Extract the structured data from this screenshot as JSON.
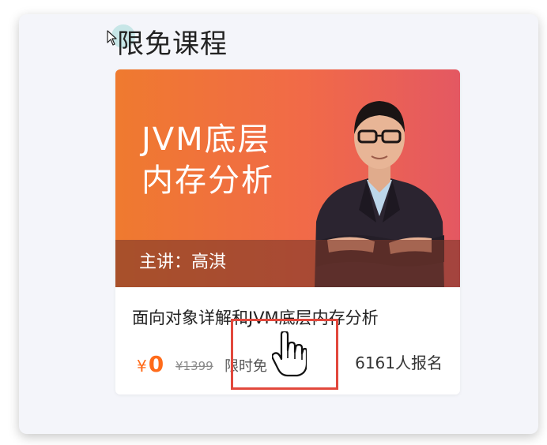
{
  "section": {
    "title": "限免课程"
  },
  "course": {
    "banner_line1": "JVM底层",
    "banner_line2": "内存分析",
    "instructor_label": "主讲：高淇",
    "name": "面向对象详解和JVM底层内存分析",
    "price_symbol": "¥",
    "price_value": "0",
    "original_price": "¥1399",
    "free_tag": "限时免",
    "enroll_count": "6161人报名"
  },
  "colors": {
    "accent": "#ff6b1a",
    "banner_start": "#ef7a2f",
    "banner_end": "#e45862",
    "highlight": "#e2483c"
  },
  "icons": {
    "pointer": "arrow-cursor-icon",
    "hand": "hand-cursor-icon"
  }
}
